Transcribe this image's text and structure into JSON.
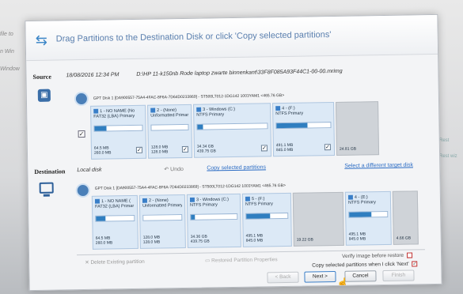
{
  "background": {
    "side_items": [
      "file to",
      "n Win",
      "Window"
    ],
    "right_items": [
      "Rest",
      "Rest wiz"
    ]
  },
  "dialog": {
    "title": "Drag Partitions to the Destination Disk or click 'Copy selected partitions'",
    "source": {
      "label": "Source",
      "date": "18/08/2016 12:34 PM",
      "path": "D:\\HP 11-k150nb Rode laptop zwarte binnenkant\\33F8F085A93F44C1-00-00.mrimg",
      "disk_header": "GPT Disk 1 [DA900557-75A4-4FAC-8F6A-7D64D0233869] - ST500LT012-1DG142 1003YAM1  <465.76 GB>",
      "partitions": [
        {
          "name": "1 - NO NAME (No",
          "type": "FAT32 (LBA) Primary",
          "used": "64.5 MB",
          "total": "260.0 MB",
          "fill": 0.25,
          "checked": true
        },
        {
          "name": "2 - (None)",
          "type": "Unformatted Primary",
          "used": "128.0 MB",
          "total": "128.0 MB",
          "fill": 0.0,
          "checked": true
        },
        {
          "name": "3 - Windows (C:)",
          "type": "NTFS Primary",
          "used": "34.34 GB",
          "total": "439.75 GB",
          "fill": 0.08,
          "checked": true
        },
        {
          "name": "4 - (F:)",
          "type": "NTFS Primary",
          "used": "491.1 MB",
          "total": "845.0 MB",
          "fill": 0.58,
          "checked": true
        },
        {
          "name": "",
          "type": "",
          "used": "",
          "total": "24.81 GB",
          "fill": 0,
          "checked": false,
          "unallocated": true
        }
      ]
    },
    "destination": {
      "label": "Destination",
      "disk_name": "Local disk",
      "undo": "Undo",
      "copy_selected": "Copy selected partitions",
      "select_target": "Select a different target disk",
      "disk_header": "GPT Disk 1 [DA900557-75A4-4FAC-8F6A-7D64D0233869] - ST500LT012-1DG142 1003YAM1  <465.76 GB>",
      "partitions": [
        {
          "name": "1 - NO NAME (",
          "type": "FAT32 (LBA) Primar",
          "used": "64.5 MB",
          "total": "260.0 MB",
          "fill": 0.25
        },
        {
          "name": "2 - (None)",
          "type": "Unformatted Primary",
          "used": "128.0 MB",
          "total": "128.0 MB",
          "fill": 0.0
        },
        {
          "name": "3 - Windows (C:)",
          "type": "NTFS Primary",
          "used": "34.36 GB",
          "total": "439.75 GB",
          "fill": 0.08
        },
        {
          "name": "5 - (F:)",
          "type": "NTFS Primary",
          "used": "495.1 MB",
          "total": "845.0 MB",
          "fill": 0.58
        },
        {
          "name": "",
          "type": "",
          "used": "",
          "total": "19.22 GB",
          "fill": 0,
          "unallocated": true
        },
        {
          "name": "4 - (E:)",
          "type": "NTFS Primary",
          "used": "495.1 MB",
          "total": "845.0 MB",
          "fill": 0.58
        },
        {
          "name": "",
          "type": "",
          "used": "",
          "total": "4.66 GB",
          "fill": 0,
          "unallocated": true
        }
      ]
    },
    "delete_existing": "Delete Existing partition",
    "restored_props": "Restored Partition Properties",
    "verify_label": "Verify image before restore",
    "copy_next_label": "Copy selected partitions when I click 'Next'",
    "copy_next_checked": true,
    "buttons": {
      "back": "< Back",
      "next": "Next >",
      "cancel": "Cancel",
      "finish": "Finish"
    }
  }
}
